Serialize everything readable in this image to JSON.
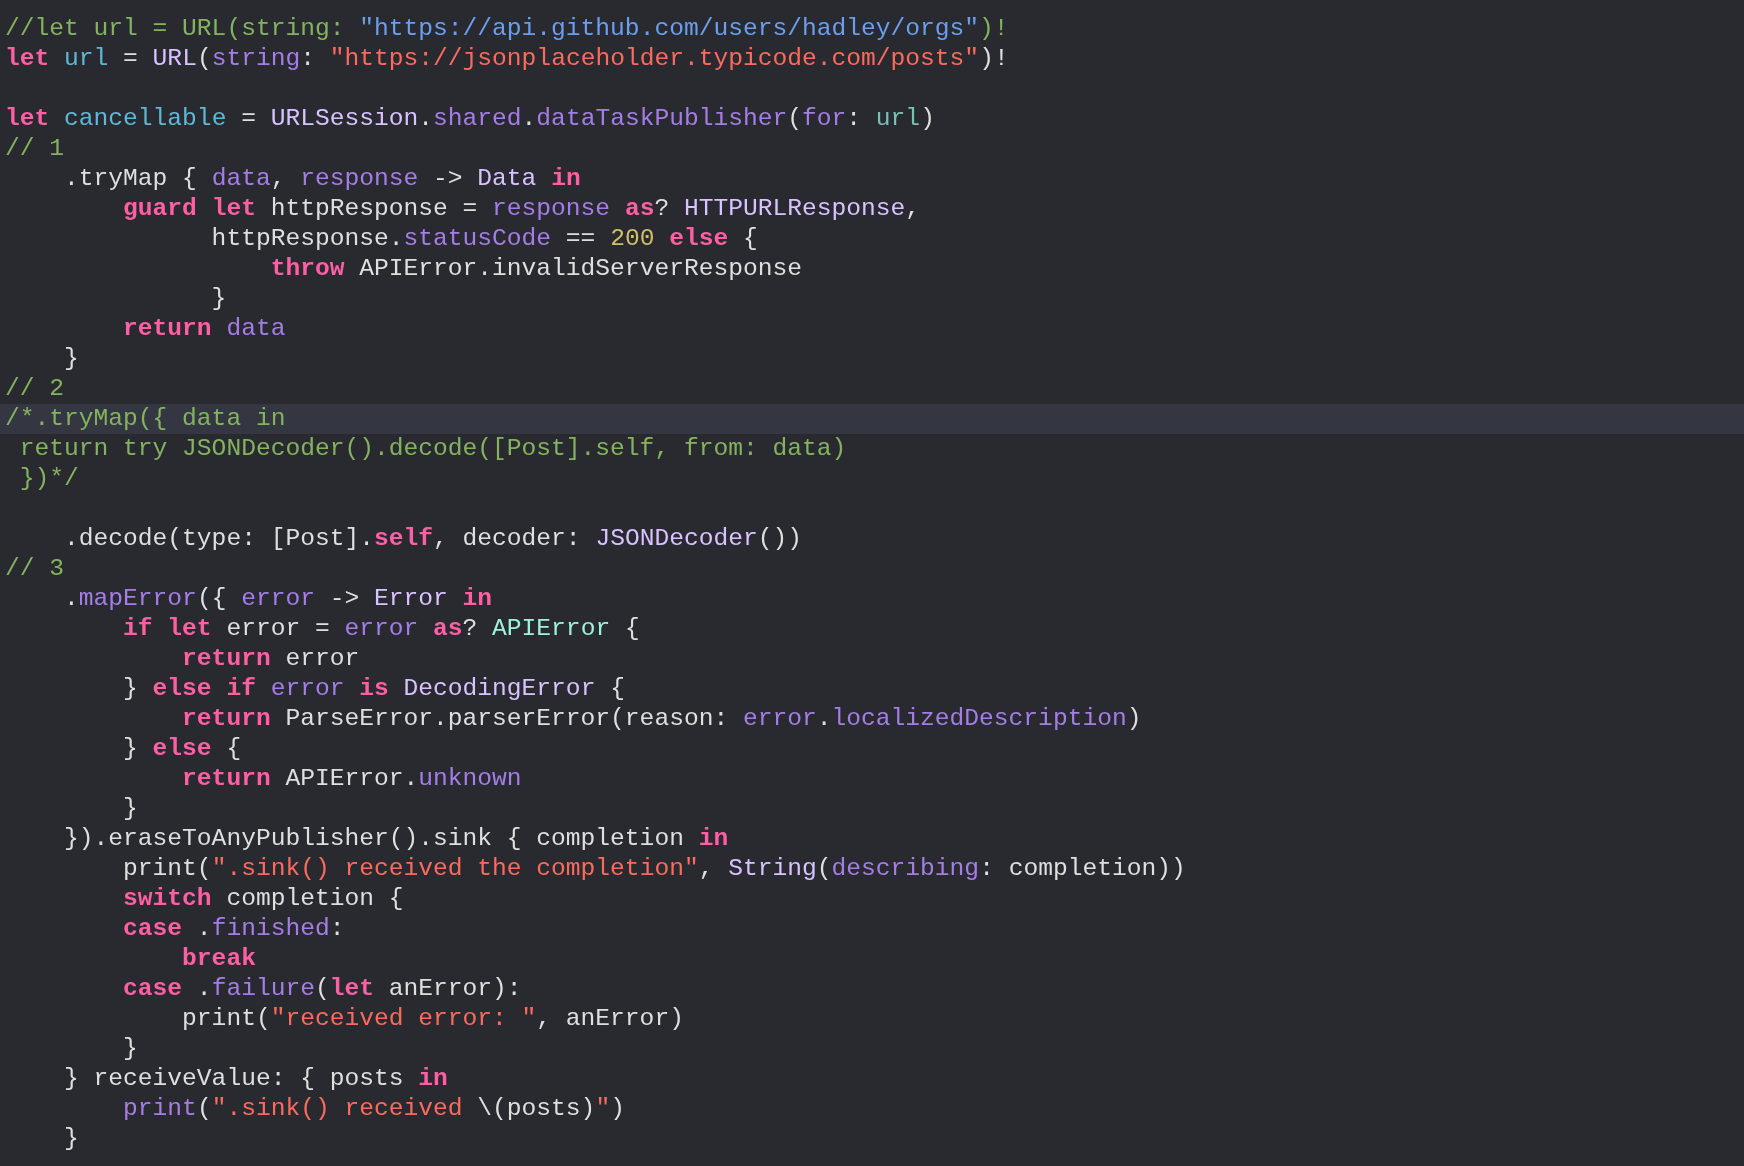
{
  "editor": {
    "lines": [
      {
        "highlighted": false,
        "tokens": [
          {
            "kind": "comment",
            "text": "//let url = URL(string: "
          },
          {
            "kind": "link",
            "text": "\"https://api.github.com/users/hadley/orgs\""
          },
          {
            "kind": "comment",
            "text": ")!"
          }
        ]
      },
      {
        "highlighted": false,
        "tokens": [
          {
            "kind": "keyword",
            "text": "let"
          },
          {
            "kind": "declaration",
            "text": " url"
          },
          {
            "kind": "plain",
            "text": " = "
          },
          {
            "kind": "type",
            "text": "URL"
          },
          {
            "kind": "plain",
            "text": "("
          },
          {
            "kind": "member",
            "text": "string"
          },
          {
            "kind": "plain",
            "text": ": "
          },
          {
            "kind": "string",
            "text": "\"https://jsonplaceholder.typicode.com/posts\""
          },
          {
            "kind": "plain",
            "text": ")!"
          }
        ]
      },
      {
        "highlighted": false
      },
      {
        "highlighted": false,
        "tokens": [
          {
            "kind": "keyword",
            "text": "let"
          },
          {
            "kind": "declaration",
            "text": " cancellable"
          },
          {
            "kind": "plain",
            "text": " = "
          },
          {
            "kind": "type",
            "text": "URLSession"
          },
          {
            "kind": "plain",
            "text": "."
          },
          {
            "kind": "member",
            "text": "shared"
          },
          {
            "kind": "plain",
            "text": "."
          },
          {
            "kind": "member",
            "text": "dataTaskPublisher"
          },
          {
            "kind": "plain",
            "text": "("
          },
          {
            "kind": "member",
            "text": "for"
          },
          {
            "kind": "plain",
            "text": ": "
          },
          {
            "kind": "local",
            "text": "url"
          },
          {
            "kind": "plain",
            "text": ")"
          }
        ]
      },
      {
        "highlighted": false,
        "tokens": [
          {
            "kind": "comment",
            "text": "// 1"
          }
        ]
      },
      {
        "highlighted": false,
        "tokens": [
          {
            "kind": "plain",
            "text": "    .tryMap { "
          },
          {
            "kind": "member",
            "text": "data"
          },
          {
            "kind": "plain",
            "text": ", "
          },
          {
            "kind": "member",
            "text": "response"
          },
          {
            "kind": "plain",
            "text": " -> "
          },
          {
            "kind": "type",
            "text": "Data"
          },
          {
            "kind": "keyword",
            "text": " in"
          }
        ]
      },
      {
        "highlighted": false,
        "tokens": [
          {
            "kind": "keyword",
            "text": "        guard"
          },
          {
            "kind": "keyword",
            "text": " let"
          },
          {
            "kind": "plain",
            "text": " httpResponse = "
          },
          {
            "kind": "member",
            "text": "response"
          },
          {
            "kind": "keyword",
            "text": " as"
          },
          {
            "kind": "plain",
            "text": "? "
          },
          {
            "kind": "type",
            "text": "HTTPURLResponse"
          },
          {
            "kind": "plain",
            "text": ","
          }
        ]
      },
      {
        "highlighted": false,
        "tokens": [
          {
            "kind": "plain",
            "text": "              httpResponse."
          },
          {
            "kind": "member",
            "text": "statusCode"
          },
          {
            "kind": "plain",
            "text": " == "
          },
          {
            "kind": "number",
            "text": "200"
          },
          {
            "kind": "keyword",
            "text": " else"
          },
          {
            "kind": "plain",
            "text": " {"
          }
        ]
      },
      {
        "highlighted": false,
        "tokens": [
          {
            "kind": "keyword",
            "text": "                  throw"
          },
          {
            "kind": "plain",
            "text": " APIError.invalidServerResponse"
          }
        ]
      },
      {
        "highlighted": false,
        "tokens": [
          {
            "kind": "plain",
            "text": "              }"
          }
        ]
      },
      {
        "highlighted": false,
        "tokens": [
          {
            "kind": "keyword",
            "text": "        return"
          },
          {
            "kind": "member",
            "text": " data"
          }
        ]
      },
      {
        "highlighted": false,
        "tokens": [
          {
            "kind": "plain",
            "text": "    }"
          }
        ]
      },
      {
        "highlighted": false,
        "tokens": [
          {
            "kind": "comment",
            "text": "// 2"
          }
        ]
      },
      {
        "highlighted": true,
        "tokens": [
          {
            "kind": "comment",
            "text": "/*.tryMap({ data in"
          }
        ]
      },
      {
        "highlighted": false,
        "tokens": [
          {
            "kind": "comment",
            "text": " return try JSONDecoder().decode([Post].self, from: data)"
          }
        ]
      },
      {
        "highlighted": false,
        "tokens": [
          {
            "kind": "comment",
            "text": " })*/"
          }
        ]
      },
      {
        "highlighted": false
      },
      {
        "highlighted": false,
        "tokens": [
          {
            "kind": "plain",
            "text": "    .decode(type: [Post]."
          },
          {
            "kind": "keyword",
            "text": "self"
          },
          {
            "kind": "plain",
            "text": ", decoder: "
          },
          {
            "kind": "type",
            "text": "JSONDecoder"
          },
          {
            "kind": "plain",
            "text": "())"
          }
        ]
      },
      {
        "highlighted": false,
        "tokens": [
          {
            "kind": "comment",
            "text": "// 3"
          }
        ]
      },
      {
        "highlighted": false,
        "tokens": [
          {
            "kind": "plain",
            "text": "    ."
          },
          {
            "kind": "member",
            "text": "mapError"
          },
          {
            "kind": "plain",
            "text": "({ "
          },
          {
            "kind": "member",
            "text": "error"
          },
          {
            "kind": "plain",
            "text": " -> "
          },
          {
            "kind": "type",
            "text": "Error"
          },
          {
            "kind": "keyword",
            "text": " in"
          }
        ]
      },
      {
        "highlighted": false,
        "tokens": [
          {
            "kind": "keyword",
            "text": "        if"
          },
          {
            "kind": "keyword",
            "text": " let"
          },
          {
            "kind": "plain",
            "text": " error = "
          },
          {
            "kind": "member",
            "text": "error"
          },
          {
            "kind": "keyword",
            "text": " as"
          },
          {
            "kind": "plain",
            "text": "? "
          },
          {
            "kind": "project-type",
            "text": "APIError"
          },
          {
            "kind": "plain",
            "text": " {"
          }
        ]
      },
      {
        "highlighted": false,
        "tokens": [
          {
            "kind": "keyword",
            "text": "            return"
          },
          {
            "kind": "plain",
            "text": " error"
          }
        ]
      },
      {
        "highlighted": false,
        "tokens": [
          {
            "kind": "plain",
            "text": "        } "
          },
          {
            "kind": "keyword",
            "text": "else"
          },
          {
            "kind": "keyword",
            "text": " if"
          },
          {
            "kind": "member",
            "text": " error"
          },
          {
            "kind": "keyword",
            "text": " is"
          },
          {
            "kind": "type",
            "text": " DecodingError"
          },
          {
            "kind": "plain",
            "text": " {"
          }
        ]
      },
      {
        "highlighted": false,
        "tokens": [
          {
            "kind": "keyword",
            "text": "            return"
          },
          {
            "kind": "plain",
            "text": " ParseError.parserError(reason: "
          },
          {
            "kind": "member",
            "text": "error"
          },
          {
            "kind": "plain",
            "text": "."
          },
          {
            "kind": "member",
            "text": "localizedDescription"
          },
          {
            "kind": "plain",
            "text": ")"
          }
        ]
      },
      {
        "highlighted": false,
        "tokens": [
          {
            "kind": "plain",
            "text": "        } "
          },
          {
            "kind": "keyword",
            "text": "else"
          },
          {
            "kind": "plain",
            "text": " {"
          }
        ]
      },
      {
        "highlighted": false,
        "tokens": [
          {
            "kind": "keyword",
            "text": "            return"
          },
          {
            "kind": "plain",
            "text": " APIError."
          },
          {
            "kind": "member",
            "text": "unknown"
          }
        ]
      },
      {
        "highlighted": false,
        "tokens": [
          {
            "kind": "plain",
            "text": "        }"
          }
        ]
      },
      {
        "highlighted": false,
        "tokens": [
          {
            "kind": "plain",
            "text": "    }).eraseToAnyPublisher().sink { completion "
          },
          {
            "kind": "keyword",
            "text": "in"
          }
        ]
      },
      {
        "highlighted": false,
        "tokens": [
          {
            "kind": "plain",
            "text": "        print("
          },
          {
            "kind": "string",
            "text": "\".sink() received the completion\""
          },
          {
            "kind": "plain",
            "text": ", "
          },
          {
            "kind": "type",
            "text": "String"
          },
          {
            "kind": "plain",
            "text": "("
          },
          {
            "kind": "member",
            "text": "describing"
          },
          {
            "kind": "plain",
            "text": ": completion))"
          }
        ]
      },
      {
        "highlighted": false,
        "tokens": [
          {
            "kind": "keyword",
            "text": "        switch"
          },
          {
            "kind": "plain",
            "text": " completion {"
          }
        ]
      },
      {
        "highlighted": false,
        "tokens": [
          {
            "kind": "keyword",
            "text": "        case"
          },
          {
            "kind": "plain",
            "text": " ."
          },
          {
            "kind": "member",
            "text": "finished"
          },
          {
            "kind": "plain",
            "text": ":"
          }
        ]
      },
      {
        "highlighted": false,
        "tokens": [
          {
            "kind": "keyword",
            "text": "            break"
          }
        ]
      },
      {
        "highlighted": false,
        "tokens": [
          {
            "kind": "keyword",
            "text": "        case"
          },
          {
            "kind": "plain",
            "text": " ."
          },
          {
            "kind": "member",
            "text": "failure"
          },
          {
            "kind": "plain",
            "text": "("
          },
          {
            "kind": "keyword",
            "text": "let"
          },
          {
            "kind": "plain",
            "text": " anError):"
          }
        ]
      },
      {
        "highlighted": false,
        "tokens": [
          {
            "kind": "plain",
            "text": "            print("
          },
          {
            "kind": "string",
            "text": "\"received error: \""
          },
          {
            "kind": "plain",
            "text": ", anError)"
          }
        ]
      },
      {
        "highlighted": false,
        "tokens": [
          {
            "kind": "plain",
            "text": "        }"
          }
        ]
      },
      {
        "highlighted": false,
        "tokens": [
          {
            "kind": "plain",
            "text": "    } receiveValue: { posts "
          },
          {
            "kind": "keyword",
            "text": "in"
          }
        ]
      },
      {
        "highlighted": false,
        "tokens": [
          {
            "kind": "member",
            "text": "        print"
          },
          {
            "kind": "plain",
            "text": "("
          },
          {
            "kind": "string",
            "text": "\".sink() received "
          },
          {
            "kind": "plain",
            "text": "\\(posts)"
          },
          {
            "kind": "string",
            "text": "\""
          },
          {
            "kind": "plain",
            "text": ")"
          }
        ]
      },
      {
        "highlighted": false,
        "tokens": [
          {
            "kind": "plain",
            "text": "    }"
          }
        ]
      }
    ]
  }
}
